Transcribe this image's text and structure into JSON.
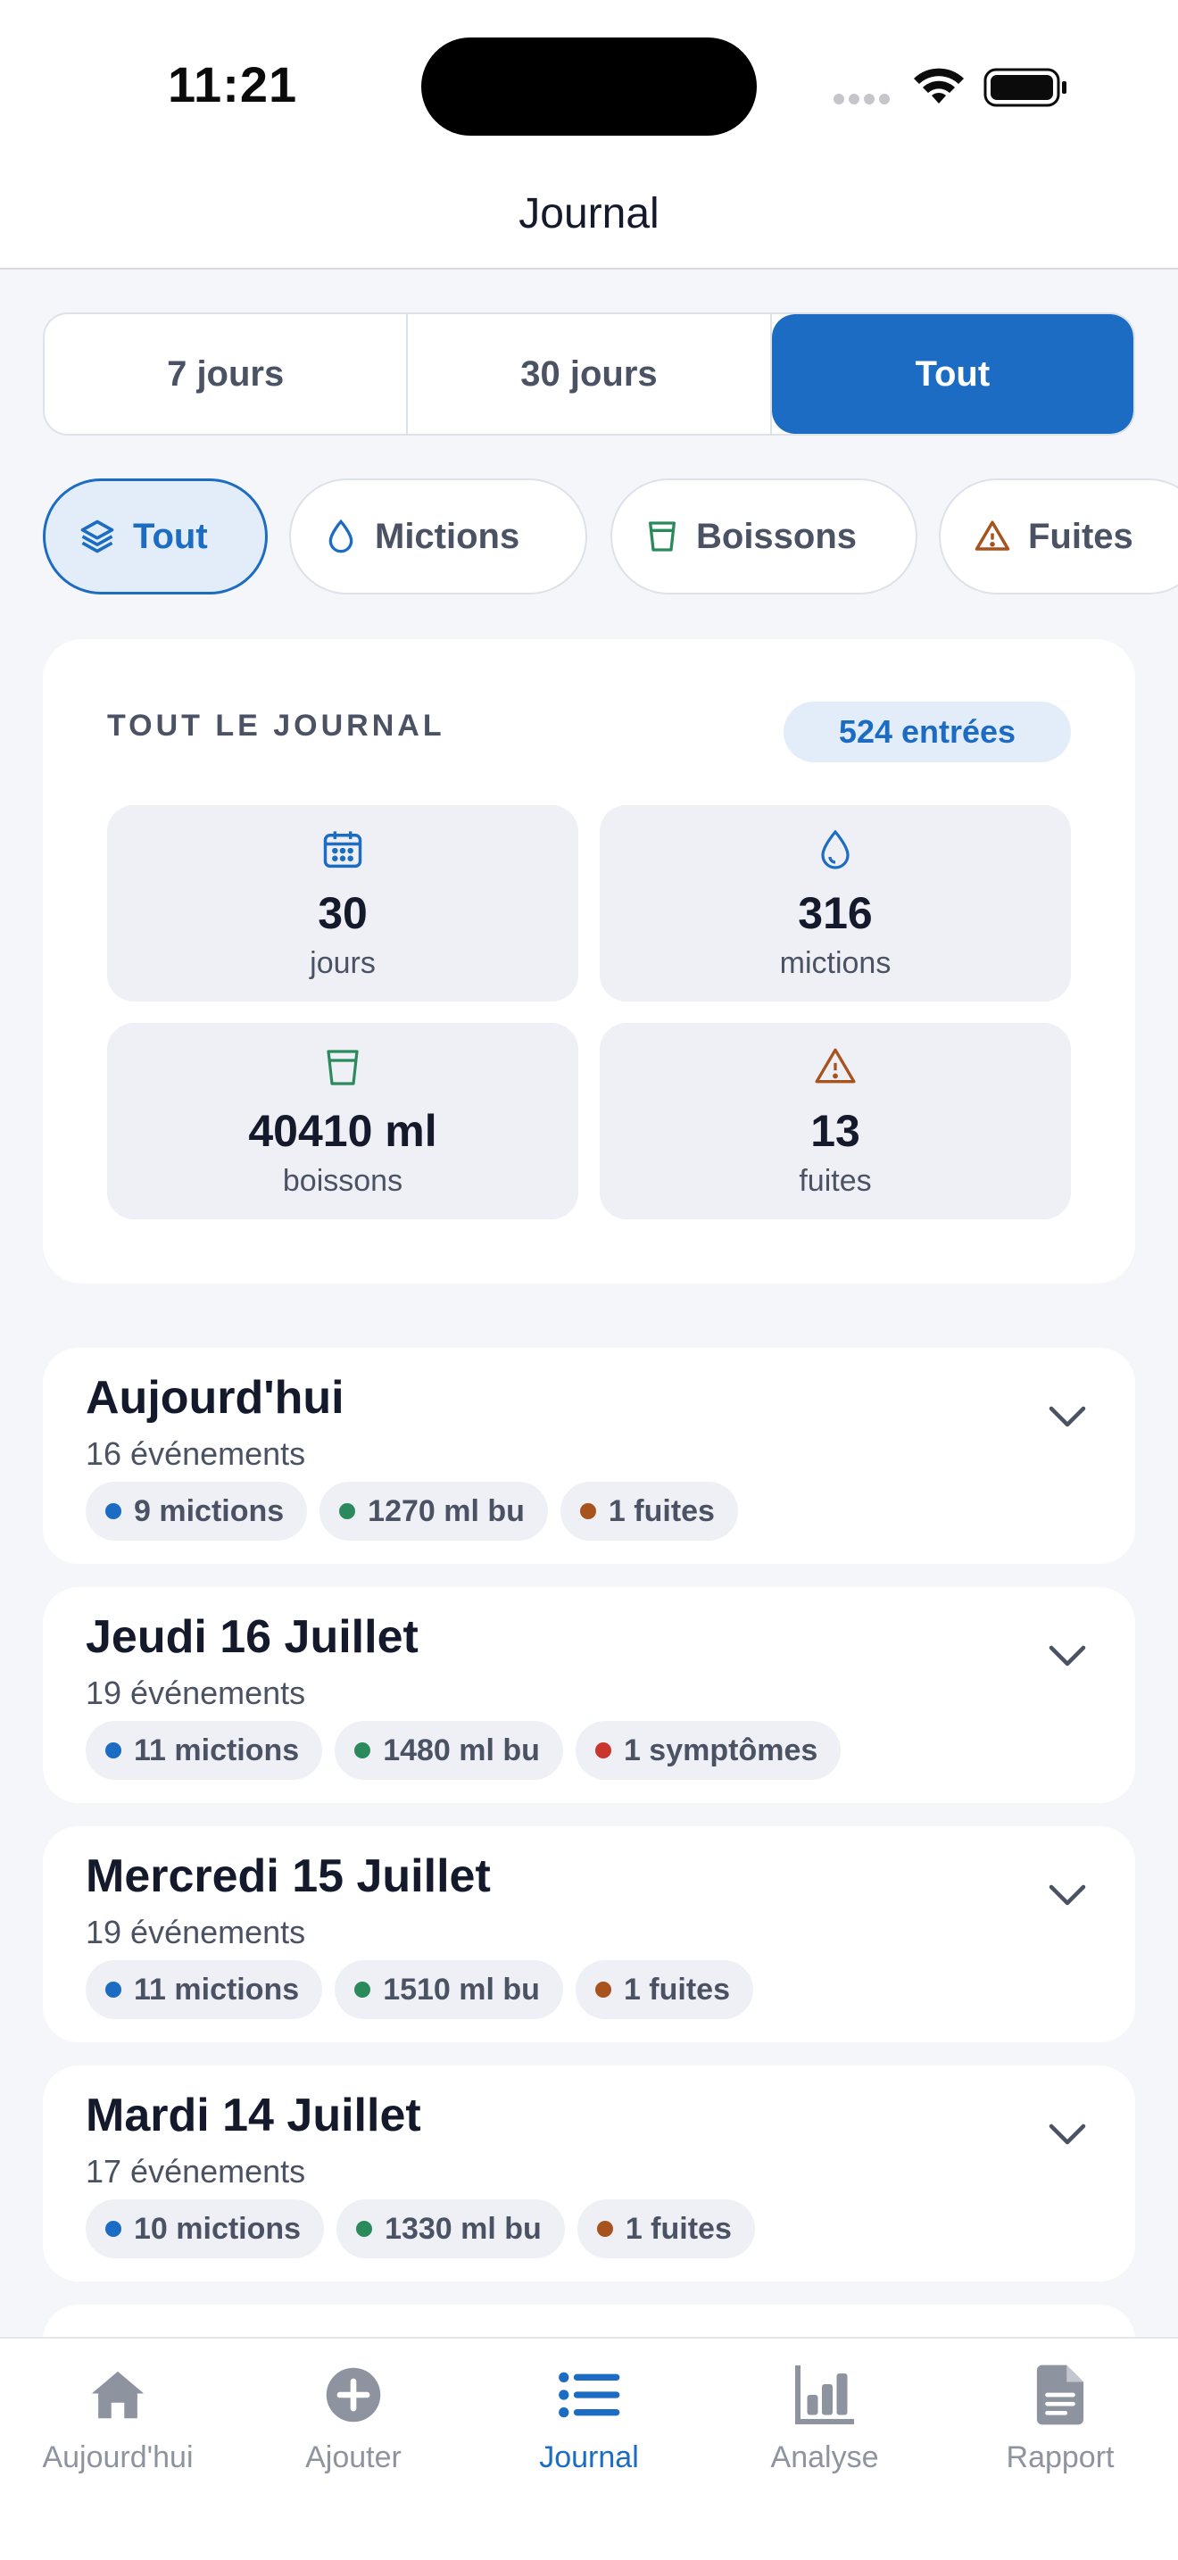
{
  "status_bar": {
    "time": "11:21"
  },
  "header": {
    "title": "Journal"
  },
  "period_segments": [
    {
      "label": "7 jours",
      "active": false
    },
    {
      "label": "30 jours",
      "active": false
    },
    {
      "label": "Tout",
      "active": true
    }
  ],
  "filter_chips": [
    {
      "label": "Tout",
      "icon": "layers-icon",
      "active": true
    },
    {
      "label": "Mictions",
      "icon": "droplet-icon",
      "active": false
    },
    {
      "label": "Boissons",
      "icon": "cup-icon",
      "active": false
    },
    {
      "label": "Fuites",
      "icon": "warning-icon",
      "active": false
    }
  ],
  "summary": {
    "title": "TOUT LE JOURNAL",
    "badge": "524 entrées",
    "stats": [
      {
        "value": "30",
        "label": "jours",
        "icon": "calendar-icon",
        "color": "#1b6cc2"
      },
      {
        "value": "316",
        "label": "mictions",
        "icon": "droplet-icon",
        "color": "#1b6cc2"
      },
      {
        "value": "40410 ml",
        "label": "boissons",
        "icon": "cup-icon",
        "color": "#2a8a5c"
      },
      {
        "value": "13",
        "label": "fuites",
        "icon": "warning-icon",
        "color": "#a8521d"
      }
    ]
  },
  "days": [
    {
      "title": "Aujourd'hui",
      "subtitle": "16 événements",
      "tags": [
        {
          "text": "9 mictions",
          "color": "#1b6cc2"
        },
        {
          "text": "1270 ml bu",
          "color": "#2a8a5c"
        },
        {
          "text": "1 fuites",
          "color": "#a8521d"
        }
      ]
    },
    {
      "title": "Jeudi 16 Juillet",
      "subtitle": "19 événements",
      "tags": [
        {
          "text": "11 mictions",
          "color": "#1b6cc2"
        },
        {
          "text": "1480 ml bu",
          "color": "#2a8a5c"
        },
        {
          "text": "1 symptômes",
          "color": "#c9362e"
        }
      ]
    },
    {
      "title": "Mercredi 15 Juillet",
      "subtitle": "19 événements",
      "tags": [
        {
          "text": "11 mictions",
          "color": "#1b6cc2"
        },
        {
          "text": "1510 ml bu",
          "color": "#2a8a5c"
        },
        {
          "text": "1 fuites",
          "color": "#a8521d"
        }
      ]
    },
    {
      "title": "Mardi 14 Juillet",
      "subtitle": "17 événements",
      "tags": [
        {
          "text": "10 mictions",
          "color": "#1b6cc2"
        },
        {
          "text": "1330 ml bu",
          "color": "#2a8a5c"
        },
        {
          "text": "1 fuites",
          "color": "#a8521d"
        }
      ]
    }
  ],
  "tab_bar": [
    {
      "label": "Aujourd'hui",
      "icon": "home-icon",
      "active": false
    },
    {
      "label": "Ajouter",
      "icon": "plus-circle-icon",
      "active": false
    },
    {
      "label": "Journal",
      "icon": "list-icon",
      "active": true
    },
    {
      "label": "Analyse",
      "icon": "bar-chart-icon",
      "active": false
    },
    {
      "label": "Rapport",
      "icon": "document-icon",
      "active": false
    }
  ],
  "colors": {
    "accent": "#1b6cc2",
    "drink": "#2a8a5c",
    "leak": "#a8521d",
    "symptom": "#c9362e",
    "inactive": "#8e93a0"
  }
}
